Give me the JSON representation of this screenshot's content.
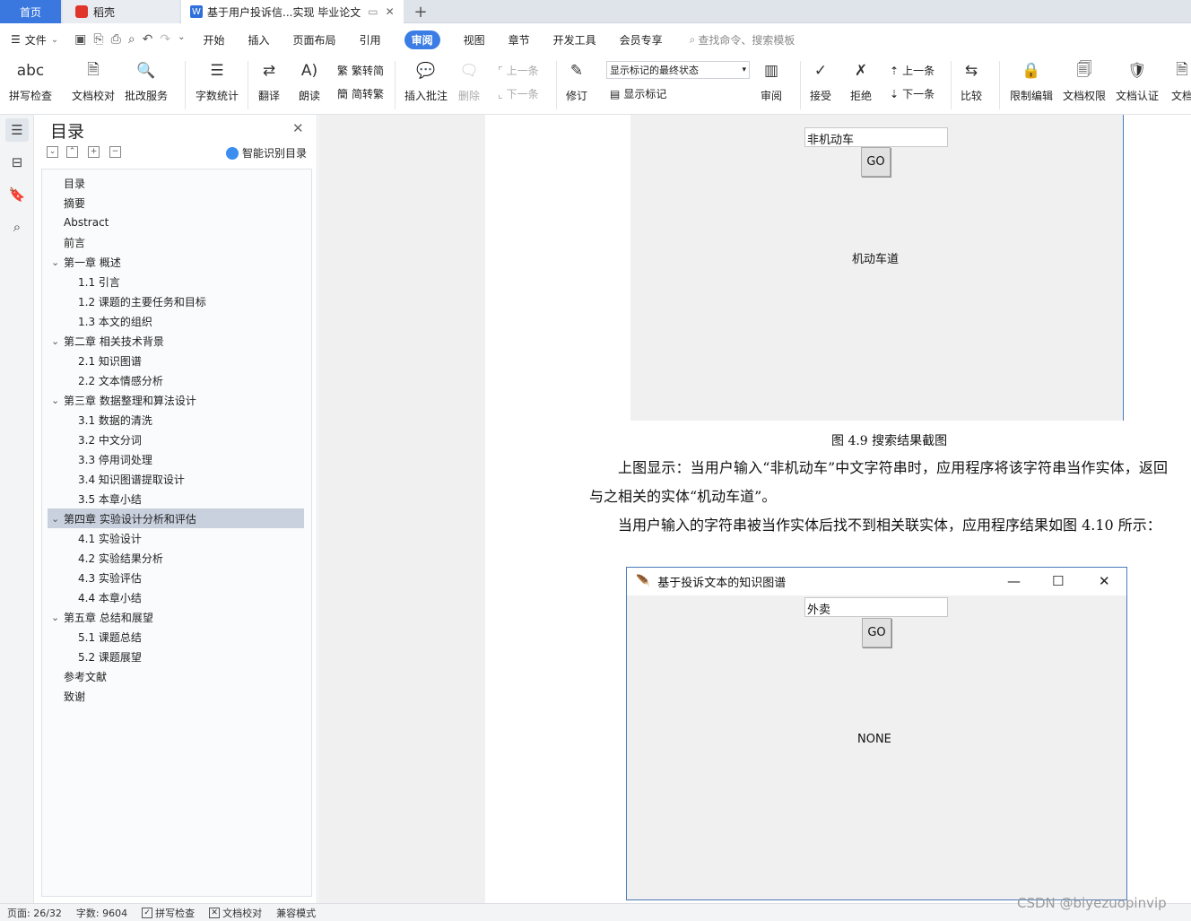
{
  "tabs": {
    "home": "首页",
    "daoke": "稻壳",
    "doc_title": "基于用户投诉信...实现 毕业论文",
    "add": "+"
  },
  "menu": {
    "file": "文件",
    "items": [
      "开始",
      "插入",
      "页面布局",
      "引用",
      "审阅",
      "视图",
      "章节",
      "开发工具",
      "会员专享"
    ],
    "active_index": 4,
    "search_placeholder": "查找命令、搜索模板"
  },
  "ribbon": {
    "spell_check": "拼写检查",
    "doc_proof": "文档校对",
    "review_service": "批改服务",
    "word_count": "字数统计",
    "translate": "翻译",
    "read_aloud": "朗读",
    "trad_to_simp": "繁转简",
    "simp_to_trad": "简转繁",
    "insert_comment": "插入批注",
    "delete": "删除",
    "prev": "上一条",
    "next": "下一条",
    "revise": "修订",
    "markup_state": "显示标记的最终状态",
    "show_markup": "显示标记",
    "review": "审阅",
    "accept": "接受",
    "reject": "拒绝",
    "prev2": "上一条",
    "next2": "下一条",
    "compare": "比较",
    "restrict_edit": "限制编辑",
    "doc_permission": "文档权限",
    "doc_cert": "文档认证",
    "doc_more": "文档"
  },
  "toc": {
    "title": "目录",
    "smart": "智能识别目录",
    "items": [
      {
        "label": "目录",
        "level": 1,
        "caret": false
      },
      {
        "label": "摘要",
        "level": 1,
        "caret": false
      },
      {
        "label": "Abstract",
        "level": 1,
        "caret": false
      },
      {
        "label": "前言",
        "level": 1,
        "caret": false
      },
      {
        "label": "第一章 概述",
        "level": 1,
        "caret": true
      },
      {
        "label": "1.1 引言",
        "level": 2,
        "caret": false
      },
      {
        "label": "1.2 课题的主要任务和目标",
        "level": 2,
        "caret": false
      },
      {
        "label": "1.3 本文的组织",
        "level": 2,
        "caret": false
      },
      {
        "label": "第二章 相关技术背景",
        "level": 1,
        "caret": true
      },
      {
        "label": "2.1 知识图谱",
        "level": 2,
        "caret": false
      },
      {
        "label": "2.2 文本情感分析",
        "level": 2,
        "caret": false
      },
      {
        "label": "第三章 数据整理和算法设计",
        "level": 1,
        "caret": true
      },
      {
        "label": "3.1 数据的清洗",
        "level": 2,
        "caret": false
      },
      {
        "label": "3.2 中文分词",
        "level": 2,
        "caret": false
      },
      {
        "label": "3.3 停用词处理",
        "level": 2,
        "caret": false
      },
      {
        "label": "3.4 知识图谱提取设计",
        "level": 2,
        "caret": false
      },
      {
        "label": "3.5 本章小结",
        "level": 2,
        "caret": false
      },
      {
        "label": "第四章 实验设计分析和评估",
        "level": 1,
        "caret": true,
        "selected": true
      },
      {
        "label": "4.1 实验设计",
        "level": 2,
        "caret": false
      },
      {
        "label": "4.2 实验结果分析",
        "level": 2,
        "caret": false
      },
      {
        "label": "4.3 实验评估",
        "level": 2,
        "caret": false
      },
      {
        "label": "4.4 本章小结",
        "level": 2,
        "caret": false
      },
      {
        "label": "第五章 总结和展望",
        "level": 1,
        "caret": true
      },
      {
        "label": "5.1 课题总结",
        "level": 2,
        "caret": false
      },
      {
        "label": "5.2 课题展望",
        "level": 2,
        "caret": false
      },
      {
        "label": "参考文献",
        "level": 1,
        "caret": false
      },
      {
        "label": "致谢",
        "level": 1,
        "caret": false
      }
    ]
  },
  "doc": {
    "fig1": {
      "input": "非机动车",
      "button": "GO",
      "result": "机动车道"
    },
    "caption": "图 4.9 搜索结果截图",
    "para1": "上图显示：当用户输入“非机动车”中文字符串时，应用程序将该字符串当作实体，返回与之相关的实体“机动车道”。",
    "para2": "当用户输入的字符串被当作实体后找不到相关联实体，应用程序结果如图 4.10 所示：",
    "fig2": {
      "title": "基于投诉文本的知识图谱",
      "input": "外卖",
      "button": "GO",
      "result": "NONE"
    }
  },
  "status": {
    "page": "页面: 26/32",
    "words": "字数: 9604",
    "spell": "拼写检查",
    "proof": "文档校对",
    "compat": "兼容模式"
  },
  "watermark": "CSDN @biyezuopinvip",
  "colors": {
    "accent": "#3b7de4",
    "selected_row": "#c9d1de",
    "window_border": "#4a7ab8"
  }
}
